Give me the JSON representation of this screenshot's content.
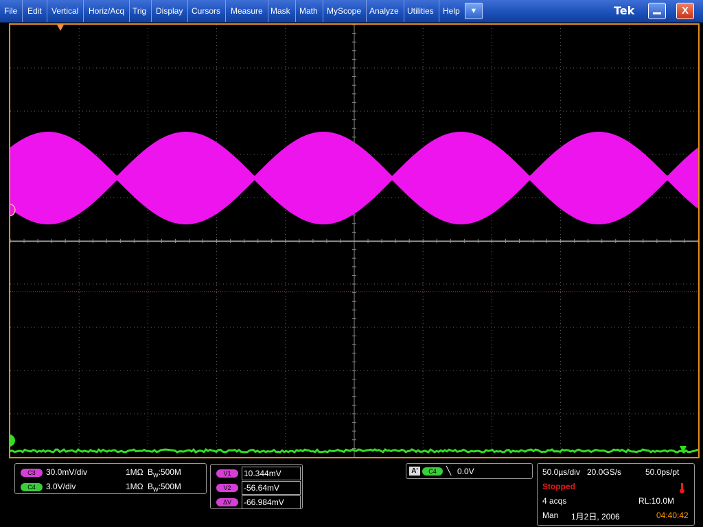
{
  "menu": {
    "items": [
      "File",
      "Edit",
      "Vertical",
      "Horiz/Acq",
      "Trig",
      "Display",
      "Cursors",
      "Measure",
      "Mask",
      "Math",
      "MyScope",
      "Analyze",
      "Utilities",
      "Help"
    ],
    "dropdown_glyph": "▼",
    "brand": "Tek",
    "close_glyph": "X"
  },
  "channels": [
    {
      "badge": "C3",
      "scale": "30.0mV/div",
      "impedance": "1MΩ",
      "bw_prefix": "B",
      "bw_sub": "W",
      "bw_value": ":500M"
    },
    {
      "badge": "C4",
      "scale": "3.0V/div",
      "impedance": "1MΩ",
      "bw_prefix": "B",
      "bw_sub": "W",
      "bw_value": ":500M"
    }
  ],
  "cursors": [
    {
      "badge": "V1",
      "value": "10.344mV"
    },
    {
      "badge": "V2",
      "value": "-56.64mV"
    },
    {
      "badge": "ΔV",
      "value": "-66.984mV"
    }
  ],
  "trigger": {
    "mode": "A'",
    "source": "C4",
    "slope_glyph": "╲",
    "level": "0.0V"
  },
  "acquisition": {
    "timebase": "50.0µs/div",
    "sample_rate": "20.0GS/s",
    "resolution": "50.0ps/pt",
    "state": "Stopped",
    "acqs": "4 acqs",
    "record_length": "RL:10.0M",
    "mode": "Man",
    "date": "1月2日, 2006",
    "time": "04:40:42"
  },
  "colors": {
    "c3_trace": "#ee14ee",
    "c4_trace": "#33dd22",
    "frame": "#e38e1a",
    "grid": "#6a6a6a"
  },
  "waveform": {
    "ch3_lobes_visible": 10,
    "ch3_peak_divisions": 1.5,
    "ch3_center_div_from_top": 4.5
  }
}
